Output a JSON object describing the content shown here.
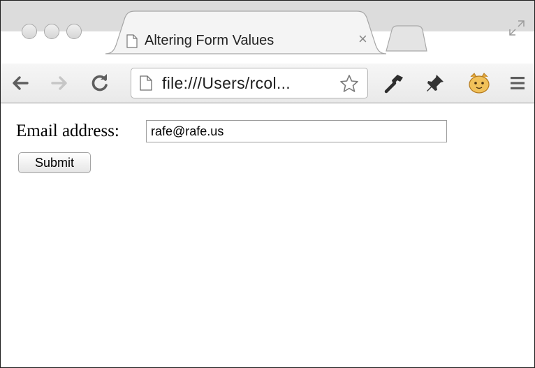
{
  "browser": {
    "tab": {
      "title": "Altering Form Values",
      "close_glyph": "×"
    },
    "address_bar": {
      "url": "file:///Users/rcol..."
    },
    "icons": {
      "back": "back-arrow-icon",
      "forward": "forward-arrow-icon",
      "reload": "reload-icon",
      "star": "bookmark-star-icon",
      "wrench": "wrench-icon",
      "pin": "pushpin-icon",
      "extension": "cat-face-extension-icon",
      "menu": "hamburger-menu-icon",
      "fullscreen": "fullscreen-icon",
      "page": "page-icon"
    }
  },
  "form": {
    "email_label": "Email address:",
    "email_value": "rafe@rafe.us",
    "submit_label": "Submit"
  }
}
